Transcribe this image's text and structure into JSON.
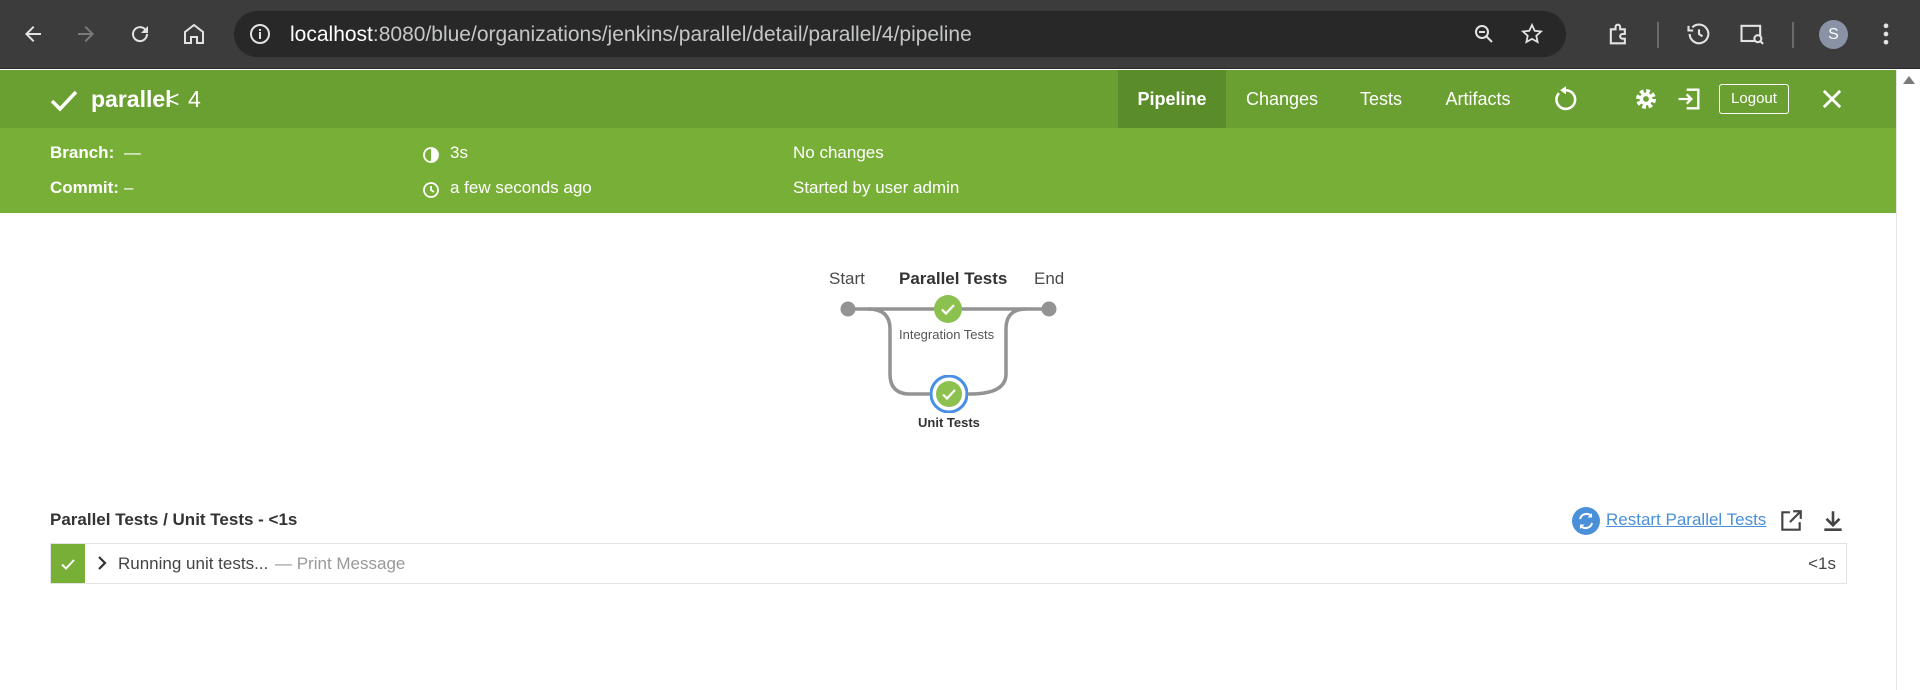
{
  "browser": {
    "url_host": "localhost",
    "url_path": ":8080/blue/organizations/jenkins/parallel/detail/parallel/4/pipeline",
    "profile_initial": "S"
  },
  "run": {
    "pipeline_name": "parallel",
    "chevron": "<",
    "run_number": "4",
    "tabs": [
      "Pipeline",
      "Changes",
      "Tests",
      "Artifacts"
    ],
    "active_tab": "Pipeline",
    "logout_label": "Logout",
    "branch_label": "Branch:",
    "branch_value": "—",
    "commit_label": "Commit:",
    "commit_value": "–",
    "duration": "3s",
    "time_ago": "a few seconds ago",
    "changes": "No changes",
    "started_by": "Started by user admin",
    "status_color": "#78b037"
  },
  "graph": {
    "start_label": "Start",
    "stage_label": "Parallel Tests",
    "end_label": "End",
    "branch_1": "Integration Tests",
    "branch_2": "Unit Tests",
    "success_color": "#8cc04f",
    "selected_ring_color": "#4a90e2"
  },
  "step_log": {
    "title": "Parallel Tests / Unit Tests - <1s",
    "restart_label": "Restart Parallel Tests",
    "step_name": "Running unit tests...",
    "step_desc": "— Print Message",
    "step_duration": "<1s"
  },
  "icons": [
    "back-icon",
    "forward-icon",
    "reload-icon",
    "home-icon",
    "info-icon",
    "zoom-icon",
    "star-icon",
    "extensions-icon",
    "history-icon",
    "search-tabs-icon",
    "menu-icon",
    "check-icon",
    "replay-icon",
    "gear-icon",
    "exit-icon",
    "close-icon",
    "duration-icon",
    "clock-icon",
    "restart-icon",
    "open-external-icon",
    "download-icon",
    "chevron-right-icon"
  ]
}
